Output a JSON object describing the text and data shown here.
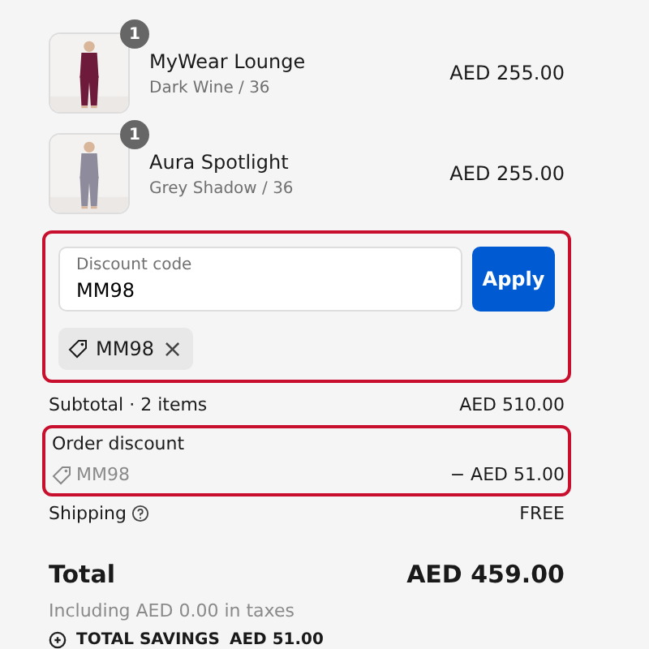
{
  "items": [
    {
      "name": "MyWear Lounge",
      "variant": "Dark Wine / 36",
      "price": "AED 255.00",
      "quantity": "1",
      "color": "#6e1a3a"
    },
    {
      "name": "Aura Spotlight",
      "variant": "Grey Shadow / 36",
      "price": "AED 255.00",
      "quantity": "1",
      "color": "#8e8c9c"
    }
  ],
  "discount": {
    "highlighted": true,
    "placeholder": "Discount code",
    "value": "MM98",
    "button": "Apply",
    "applied_code": "MM98",
    "remove": "×"
  },
  "subtotal": {
    "label": "Subtotal · 2 items",
    "value": "AED 510.00"
  },
  "order_discount": {
    "highlighted": true,
    "label": "Order discount",
    "code": "MM98",
    "value": "− AED 51.00"
  },
  "shipping": {
    "label": "Shipping",
    "value": "FREE"
  },
  "total": {
    "label": "Total",
    "value": "AED 459.00",
    "taxes": "Including AED 0.00 in taxes"
  },
  "savings": {
    "label": "TOTAL SAVINGS",
    "value": "AED 51.00"
  }
}
